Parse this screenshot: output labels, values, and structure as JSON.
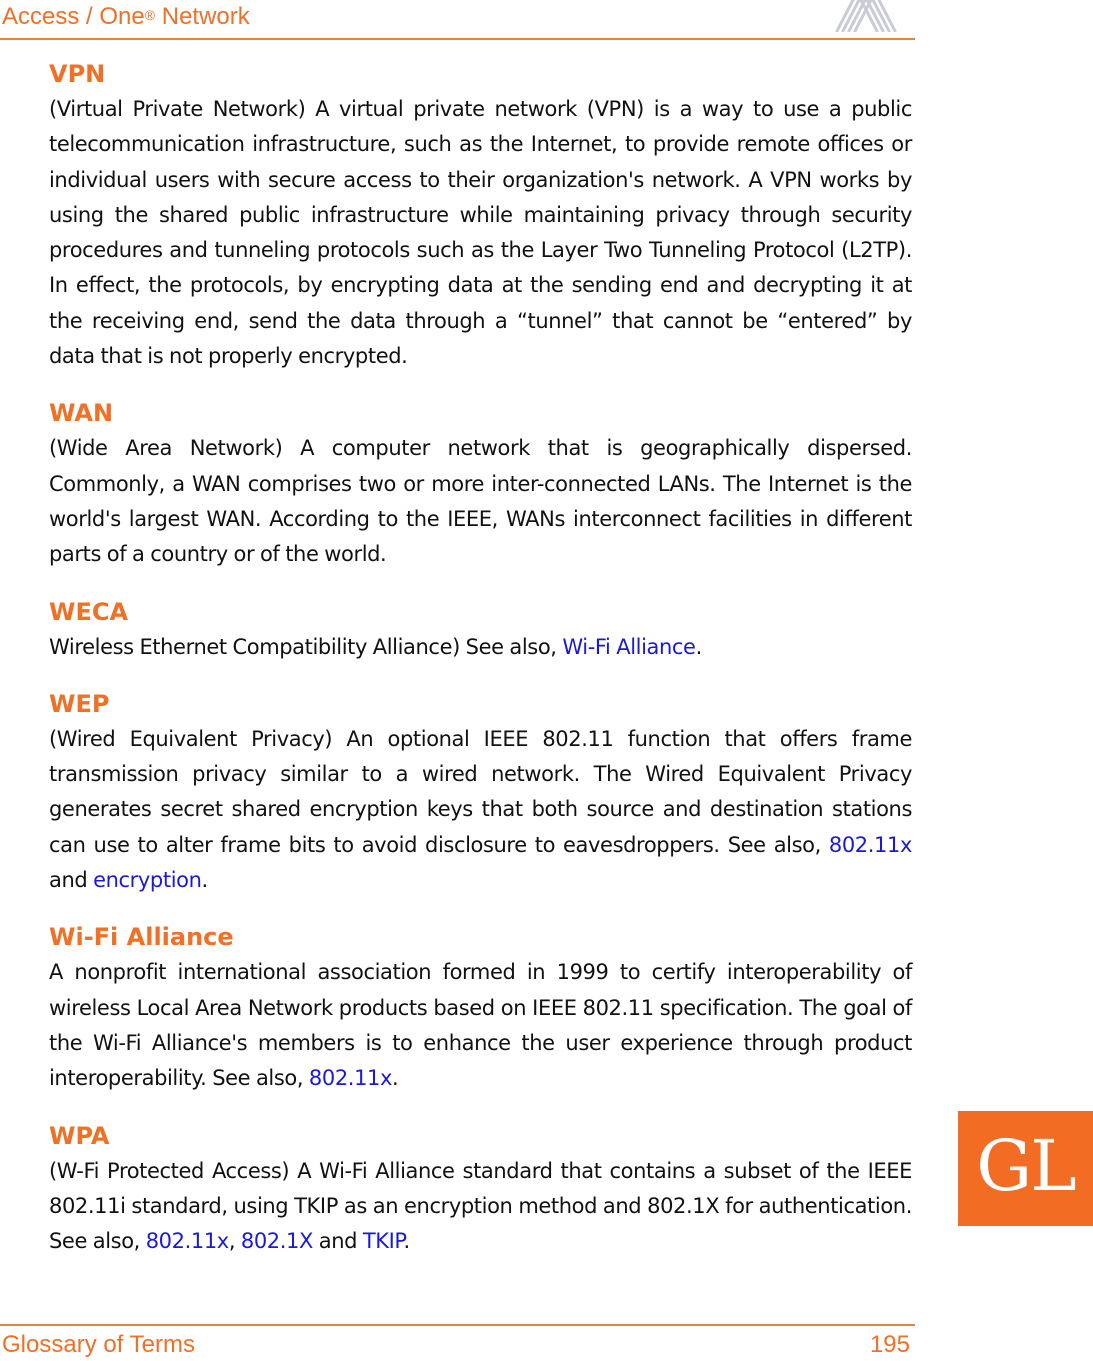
{
  "header": {
    "title": "Access / One",
    "registered": "®",
    "title_suffix": " Network"
  },
  "footer": {
    "section": "Glossary of Terms",
    "page_number": "195"
  },
  "side_tab": {
    "label": "GL"
  },
  "colors": {
    "accent": "#f07025",
    "link": "#1a1ad6",
    "tab": "#f26c24"
  },
  "entries": [
    {
      "term": "VPN",
      "definition": "(Virtual Private Network) A virtual private network (VPN) is a way to use a public telecommunication infrastructure, such as the Internet, to provide remote offices or individual users with secure access to their organization's network. A VPN works by using the shared public infrastructure while maintaining privacy through security procedures and tunneling protocols such as the Layer Two Tunneling Protocol (L2TP). In effect, the protocols, by encrypting data at the sending end and decrypting it at the receiving end, send the data through a “tunnel” that cannot be “entered” by data that is not properly encrypted."
    },
    {
      "term": "WAN",
      "definition": "(Wide Area Network) A computer network that is geographically dispersed. Commonly, a WAN comprises two or more inter-connected LANs. The Internet is the world's largest WAN. According to the IEEE, WANs interconnect facilities in different parts of a country or of the world."
    },
    {
      "term": "WECA",
      "text": "Wireless Ethernet Compatibility Alliance) See also, ",
      "links": [
        "Wi-Fi Alliance"
      ],
      "end": "."
    },
    {
      "term": "WEP",
      "text": "(Wired Equivalent Privacy) An optional IEEE 802.11 function that offers frame transmission privacy similar to a wired network. The Wired Equivalent Privacy generates secret shared encryption keys that both source and destination stations can use to alter frame bits to avoid disclosure to eavesdroppers. See also, ",
      "links": [
        "802.11x",
        "encryption"
      ],
      "sep1": " and ",
      "end": "."
    },
    {
      "term": "Wi-Fi Alliance",
      "text": "A nonprofit international association formed in 1999 to certify interoperability of wireless Local Area Network products based on IEEE 802.11 specification. The goal of the Wi-Fi Alliance's members is to enhance the user experience through product interoperability. See also, ",
      "links": [
        "802.11x"
      ],
      "end": "."
    },
    {
      "term": "WPA",
      "text": "(W-Fi Protected Access) A Wi-Fi Alliance standard that contains a subset of the IEEE 802.11i standard, using TKIP as an encryption method and 802.1X for authentication. See also, ",
      "links": [
        "802.11x",
        "802.1X",
        "TKIP"
      ],
      "sep1": ", ",
      "sep2": " and ",
      "end": "."
    }
  ]
}
